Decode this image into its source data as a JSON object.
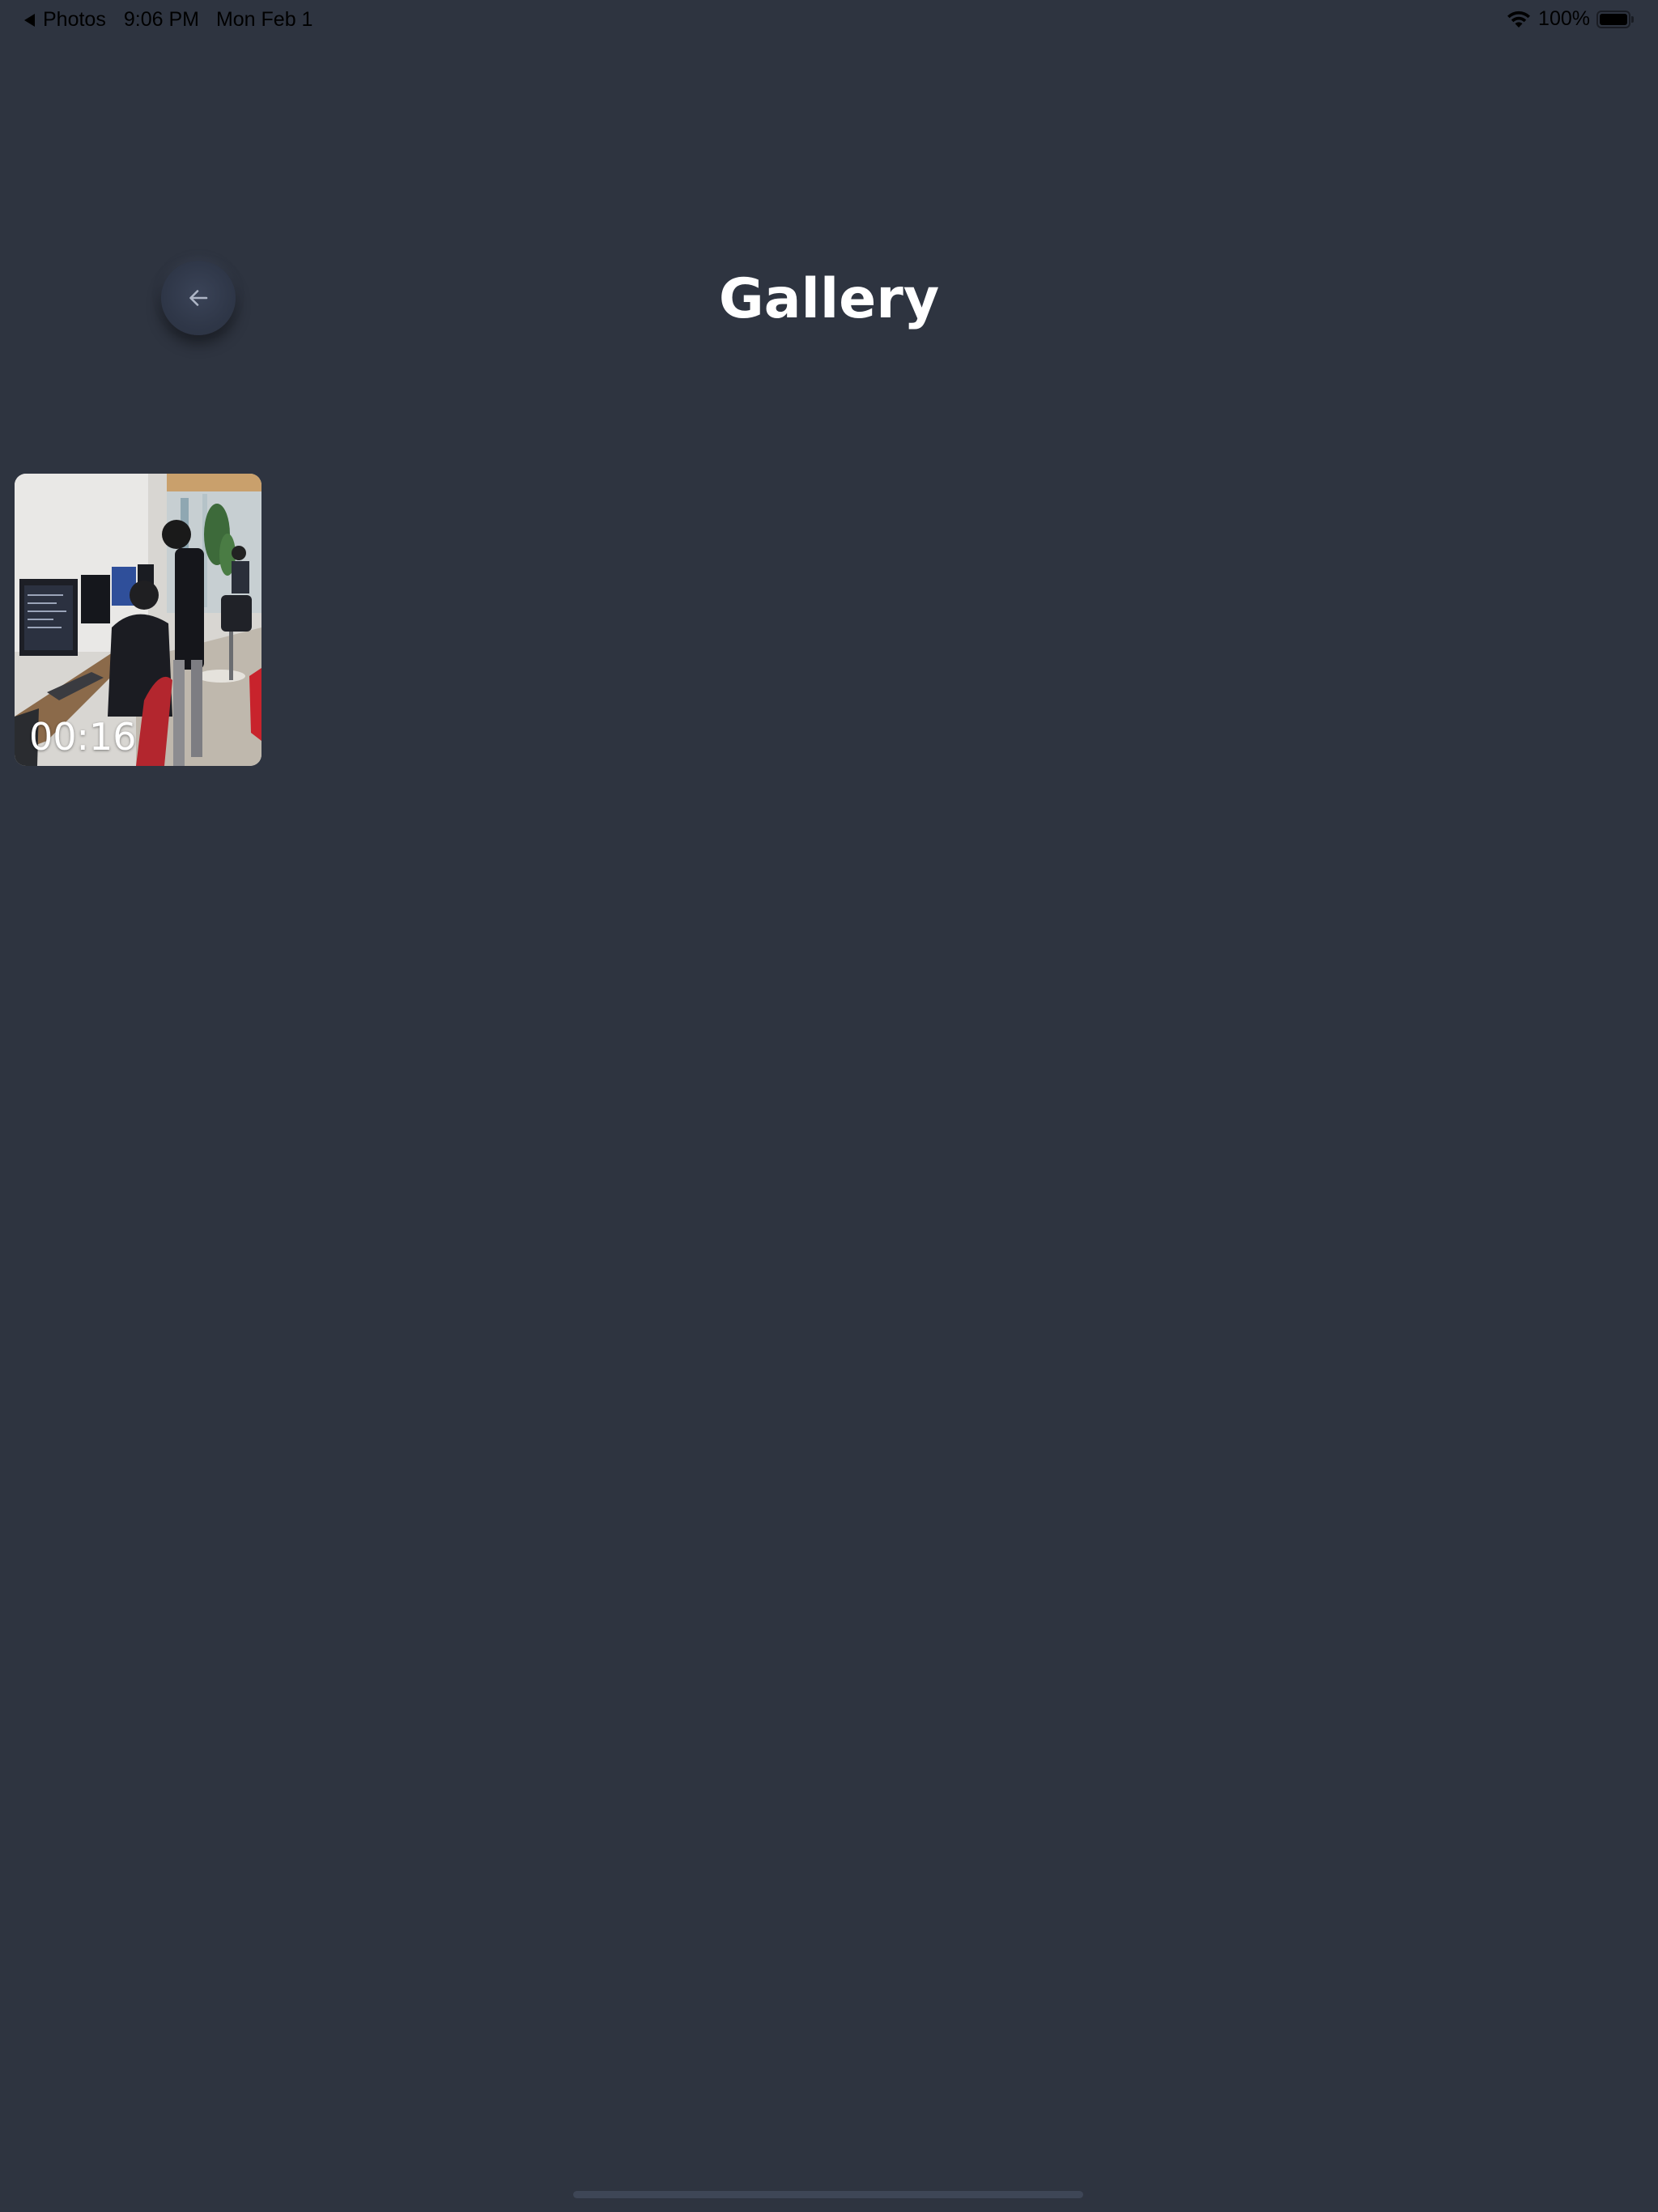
{
  "status_bar": {
    "back_app": "Photos",
    "time": "9:06 PM",
    "date": "Mon Feb 1",
    "battery_percent": "100%",
    "battery_level": 1.0
  },
  "header": {
    "title": "Gallery",
    "back_icon": "arrow-left-icon"
  },
  "gallery": {
    "items": [
      {
        "type": "video",
        "duration": "00:16"
      }
    ]
  },
  "colors": {
    "background": "#2e3440",
    "title": "#ffffff",
    "back_button": "#333b4c"
  }
}
